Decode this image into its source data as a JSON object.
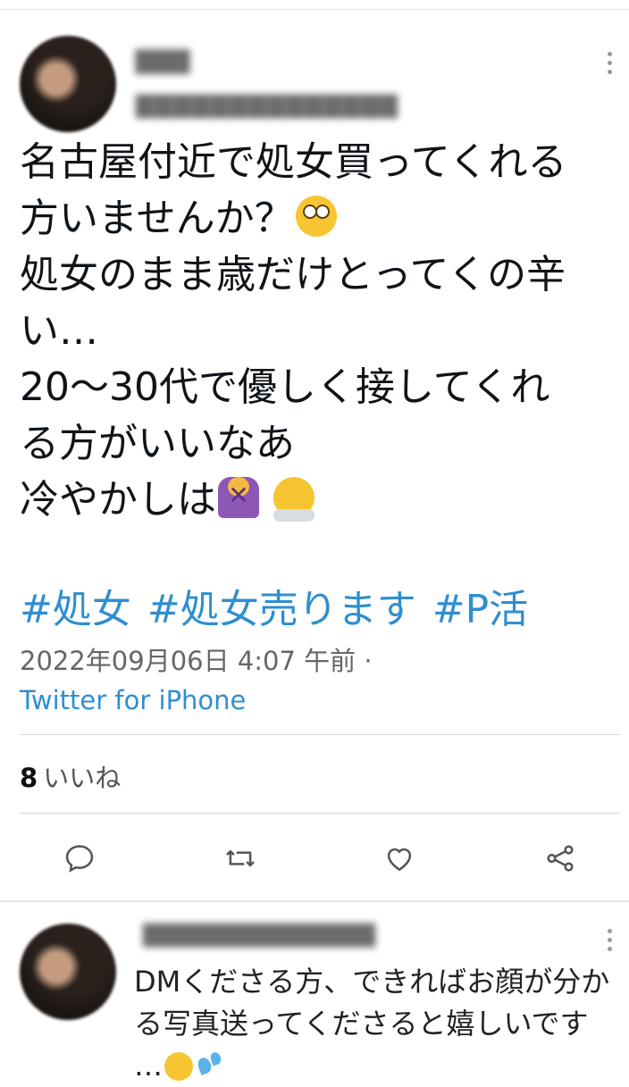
{
  "tweet": {
    "lines": [
      "名古屋付近で処女買ってくれる",
      "方いませんか？",
      "処女のまま歳だけとってくの辛",
      "い…",
      "20〜30代で優しく接してくれ",
      "る方がいいなあ",
      "冷やかしは"
    ],
    "hashtags": [
      "#処女",
      "#処女売ります",
      "#P活"
    ],
    "timestamp": "2022年09月06日 4:07 午前 ·",
    "source": "Twitter for iPhone",
    "likes_count": "8",
    "likes_label": "いいね"
  },
  "icons": [
    "more-vertical-icon",
    "reply-icon",
    "retweet-icon",
    "like-icon",
    "share-icon"
  ],
  "reply": {
    "line1": "DMくださる方、できればお顔が分か",
    "line2": "る写真送ってくださると嬉しいです",
    "line3": "…"
  },
  "colors": {
    "link": "#2f8ed0",
    "meta": "#666666"
  }
}
